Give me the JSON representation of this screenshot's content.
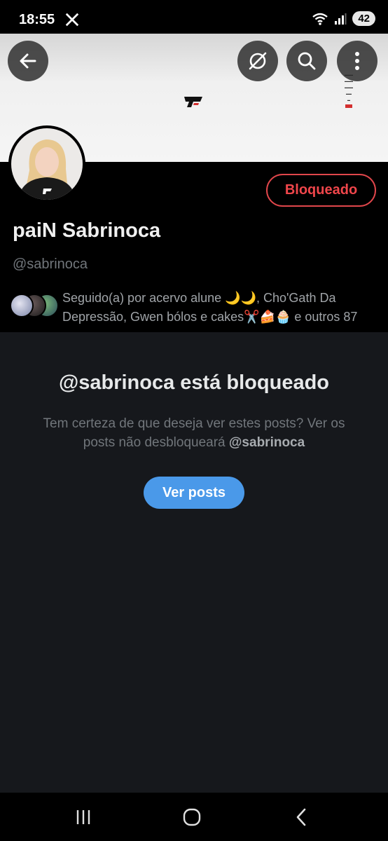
{
  "status_bar": {
    "time": "18:55",
    "battery": "42",
    "icons": [
      "x-logo-icon",
      "wifi-icon",
      "signal-icon",
      "battery-icon"
    ]
  },
  "header": {
    "buttons": [
      "back-arrow-icon",
      "grok-icon",
      "search-icon",
      "more-vertical-icon"
    ]
  },
  "profile": {
    "display_name": "paiN Sabrinoca",
    "handle": "@sabrinoca",
    "blocked_label": "Bloqueado",
    "followed_by": "Seguido(a) por acervo alune 🌙🌙, Cho'Gath Da Depressão, Gwen bólos e cakes✂️🍰🧁 e outros 87"
  },
  "blocked": {
    "title": "@sabrinoca está bloqueado",
    "description_prefix": "Tem certeza de que deseja ver estes posts? Ver os posts não desbloqueará ",
    "description_handle": "@sabrinoca",
    "view_button": "Ver posts"
  },
  "nav": {
    "recent_icon": "recent-apps-icon",
    "home_icon": "home-icon",
    "back_icon": "back-chevron-icon"
  },
  "colors": {
    "accent": "#4a99e9",
    "blocked_red": "#f0464b",
    "muted_text": "#71767b",
    "panel_bg": "#16181c"
  }
}
